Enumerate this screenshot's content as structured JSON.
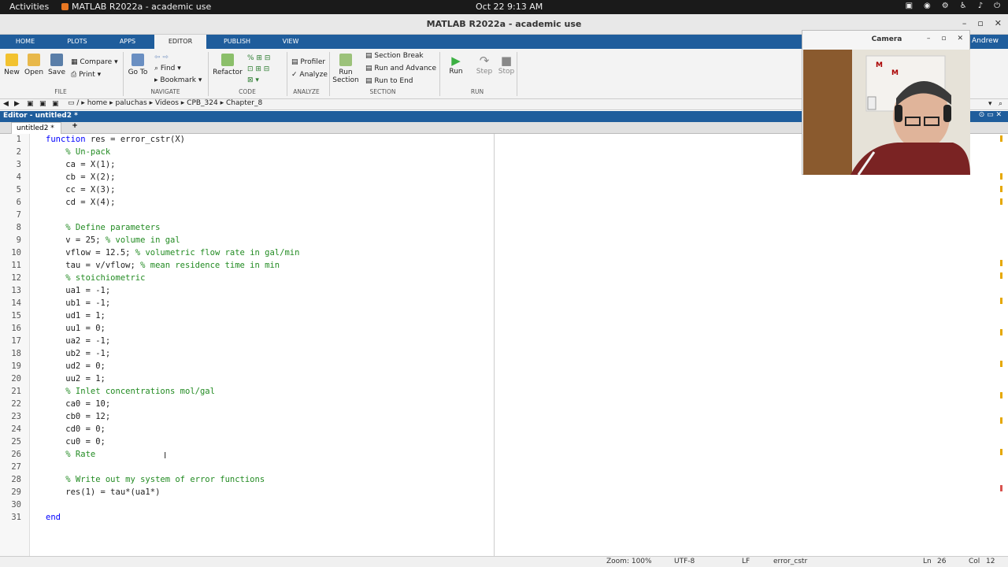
{
  "topbar": {
    "activities": "Activities",
    "app_label": "MATLAB R2022a - academic use",
    "clock": "Oct 22  9:13 AM"
  },
  "window": {
    "title": "MATLAB R2022a - academic use"
  },
  "ribbon_tabs": [
    "HOME",
    "PLOTS",
    "APPS",
    "EDITOR",
    "PUBLISH",
    "VIEW"
  ],
  "user": "Andrew",
  "file_group": {
    "new": "New",
    "open": "Open",
    "save": "Save",
    "compare": "Compare",
    "print": "Print",
    "label": "FILE"
  },
  "navigate_group": {
    "goto": "Go To",
    "find": "Find",
    "bookmark": "Bookmark",
    "label": "NAVIGATE"
  },
  "code_group": {
    "refactor": "Refactor",
    "label": "CODE"
  },
  "analyze_group": {
    "profiler": "Profiler",
    "analyze": "Analyze",
    "label": "ANALYZE"
  },
  "section_group": {
    "run_section": "Run Section",
    "section_break": "Section Break",
    "run_advance": "Run and Advance",
    "run_end": "Run to End",
    "label": "SECTION"
  },
  "run_group": {
    "run": "Run",
    "step": "Step",
    "stop": "Stop",
    "label": "RUN"
  },
  "path": [
    "/",
    "home",
    "paluchas",
    "Videos",
    "CPB_324",
    "Chapter_8"
  ],
  "editor": {
    "header": "Editor - untitled2 *",
    "tab": "untitled2 *",
    "add_tab": "+"
  },
  "code_lines": [
    "function res = error_cstr(X)",
    "    % Un-pack",
    "    ca = X(1);",
    "    cb = X(2);",
    "    cc = X(3);",
    "    cd = X(4);",
    "",
    "    % Define parameters",
    "    v = 25; % volume in gal",
    "    vflow = 12.5; % volumetric flow rate in gal/min",
    "    tau = v/vflow; % mean residence time in min",
    "    % stoichiometric",
    "    ua1 = -1;",
    "    ub1 = -1;",
    "    ud1 = 1;",
    "    uu1 = 0;",
    "    ua2 = -1;",
    "    ub2 = -1;",
    "    ud2 = 0;",
    "    uu2 = 1;",
    "    % Inlet concentrations mol/gal",
    "    ca0 = 10;",
    "    cb0 = 12;",
    "    cd0 = 0;",
    "    cu0 = 0;",
    "    % Rate ",
    "",
    "    % Write out my system of error functions",
    "    res(1) = tau*(ua1*)",
    "",
    "end"
  ],
  "status": {
    "zoom": "Zoom: 100%",
    "encoding": "UTF-8",
    "eol": "LF",
    "function": "error_cstr",
    "ln_label": "Ln",
    "ln": "26",
    "col_label": "Col",
    "col": "12"
  },
  "camera": {
    "title": "Camera"
  },
  "colors": {
    "ribbon_blue": "#1f5d9c",
    "keyword": "#0000ff",
    "comment": "#228b22"
  }
}
